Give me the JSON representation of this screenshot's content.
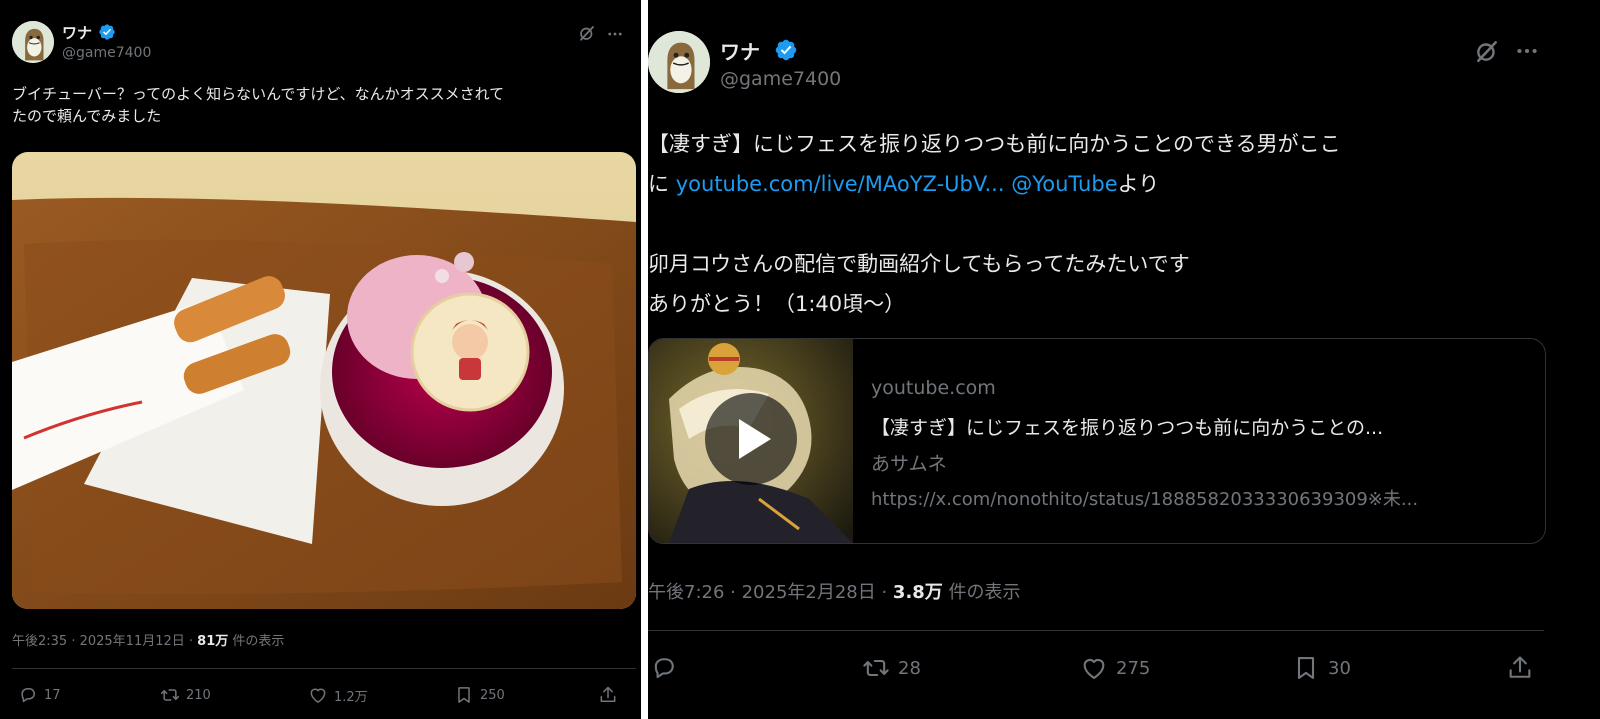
{
  "left_post": {
    "display_name": "ワナ",
    "handle": "@game7400",
    "text_line1": "ブイチューバー？ってのよく知らないんですけど、なんかオススメされて",
    "text_line2": "たので頼んでみました",
    "timestamp": "午後2:35 · 2025年11月12日 · ",
    "views_count": "81万",
    "views_label": " 件の表示",
    "actions": {
      "replies": "17",
      "reposts": "210",
      "likes": "1.2万",
      "bookmarks": "250"
    }
  },
  "right_post": {
    "display_name": "ワナ",
    "handle": "@game7400",
    "text_line1": "【凄すぎ】にじフェスを振り返りつつも前に向かうことのできる男がここ",
    "text_line2_prefix": "に ",
    "link_url": "youtube.com/live/MAoYZ-UbV...",
    "link_mention": "@YouTube",
    "text_line2_suffix": "より",
    "text_line3": "卯月コウさんの配信で動画紹介してもらってたみたいです",
    "text_line4": "ありがとう！（1:40頃〜）",
    "card": {
      "domain": "youtube.com",
      "title": "【凄すぎ】にじフェスを振り返りつつも前に向かうことの...",
      "channel": "あサムネ",
      "description": "https://x.com/nonothito/status/1888582033330639309※未..."
    },
    "timestamp": "午後7:26 · 2025年2月28日 · ",
    "views_count": "3.8万",
    "views_label": " 件の表示",
    "actions": {
      "replies": "",
      "reposts": "28",
      "likes": "275",
      "bookmarks": "30"
    }
  },
  "icons": [
    "verified-badge-icon",
    "grok-icon",
    "more-icon",
    "reply-icon",
    "repost-icon",
    "like-icon",
    "bookmark-icon",
    "share-icon",
    "play-icon"
  ],
  "colors": {
    "background": "#000000",
    "text": "#e7e9ea",
    "muted": "#71767b",
    "link": "#1d9bf0",
    "divider": "#2f3336",
    "verified": "#1d9bf0"
  }
}
